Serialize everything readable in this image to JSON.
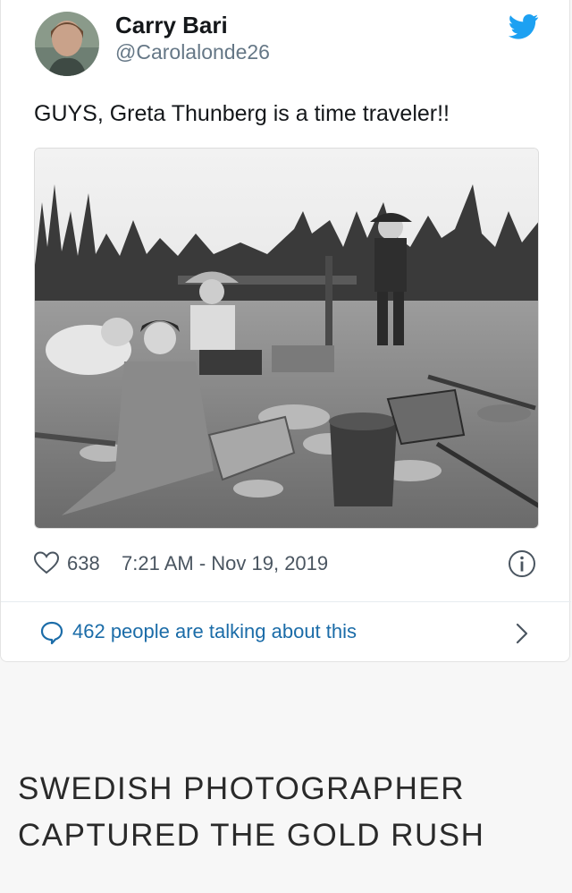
{
  "tweet": {
    "display_name": "Carry Bari",
    "handle": "@Carolalonde26",
    "text": "GUYS, Greta Thunberg is a time traveler!!",
    "likes": "638",
    "timestamp": "7:21 AM - Nov 19, 2019",
    "talking": "462 people are talking about this",
    "icons": [
      "twitter-bird-icon",
      "heart-icon",
      "info-icon",
      "speech-bubble-icon",
      "chevron-right-icon"
    ],
    "colors": {
      "bird": "#1da1f2",
      "link": "#1b6ca8",
      "muted": "#657786"
    }
  },
  "caption": {
    "line1": "SWEDISH PHOTOGRAPHER",
    "line2": "CAPTURED THE GOLD RUSH"
  }
}
